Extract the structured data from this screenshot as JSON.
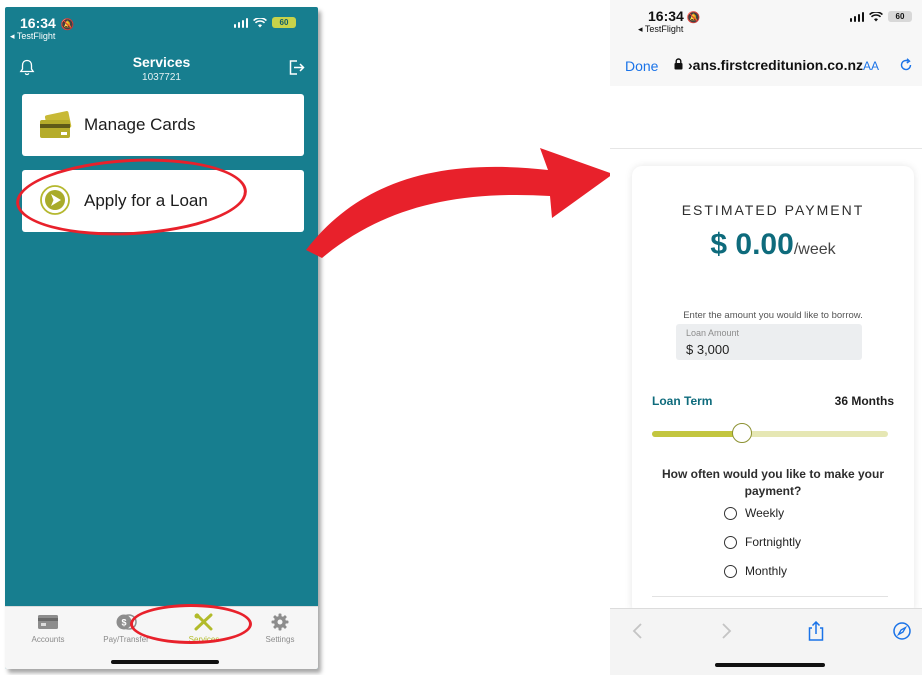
{
  "left_phone": {
    "status": {
      "time": "16:34",
      "back_app": "TestFlight",
      "battery": "60"
    },
    "header": {
      "title": "Services",
      "subtitle": "1037721"
    },
    "cards": {
      "manage": "Manage Cards",
      "loan": "Apply for a Loan"
    },
    "tabs": {
      "accounts": "Accounts",
      "pay": "Pay/Transfer",
      "services": "Services",
      "settings": "Settings"
    },
    "colors": {
      "background": "#177e8f",
      "accent": "#b2bb2a",
      "highlight": "#e8212b"
    }
  },
  "right_phone": {
    "status": {
      "time": "16:34",
      "back_app": "TestFlight",
      "battery": "60"
    },
    "browser": {
      "done": "Done",
      "url": "›ans.firstcreditunion.co.nz",
      "text_size": "AA"
    },
    "calculator": {
      "estimate_label": "ESTIMATED PAYMENT",
      "estimate_amount": "$ 0.00",
      "estimate_unit": "/week",
      "prompt": "Enter the amount you would like to borrow.",
      "amount_placeholder": "Loan Amount",
      "amount_value": "$  3,000",
      "term_label": "Loan Term",
      "term_value": "36 Months",
      "term_slider_fraction": 0.38,
      "frequency_question": "How often would you like to make your payment?",
      "options": [
        "Weekly",
        "Fortnightly",
        "Monthly"
      ]
    },
    "colors": {
      "brand": "#0e6b7c",
      "slider": "#c3c63f",
      "link": "#1a73e8"
    }
  },
  "icons": [
    "bell-icon",
    "logout-icon",
    "card-icon",
    "loan-icon",
    "accounts-icon",
    "pay-icon",
    "services-icon",
    "settings-icon",
    "lock-icon",
    "reload-icon",
    "back-icon",
    "forward-icon",
    "share-icon",
    "compass-icon",
    "arrow-icon"
  ]
}
